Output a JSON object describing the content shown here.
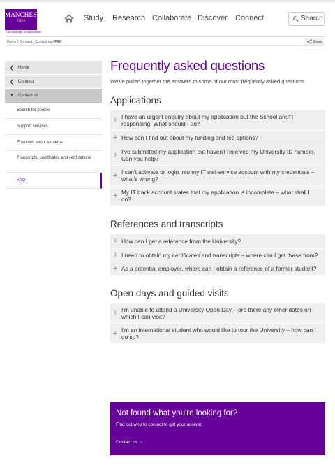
{
  "header": {
    "logo_main": "MANCHESTER",
    "logo_year": "1824",
    "logo_sub": "The University of Manchester",
    "nav": [
      "Study",
      "Research",
      "Collaborate",
      "Discover",
      "Connect"
    ],
    "search_label": "Search"
  },
  "breadcrumb": {
    "items": [
      "Home",
      "Connect",
      "Contact us"
    ],
    "separator": "/",
    "current": "FAQ",
    "share_label": "Share"
  },
  "sidebar": {
    "parents": [
      "Home",
      "Connect",
      "Contact us"
    ],
    "children": [
      "Search for people",
      "Support services",
      "Enquiries about students",
      "Transcripts, certificates and verifications",
      "FAQ"
    ]
  },
  "main": {
    "title": "Frequently asked questions",
    "intro": "We've pulled together the answers to some of our most frequently asked questions.",
    "sections": [
      {
        "heading": "Applications",
        "questions": [
          "I have an urgent enquiry about my application but the School aren't responding. What should I do?",
          "How can I find out about my funding and fee options?",
          "I've submitted my application but haven't received my University ID number. Can you help?",
          "I can't activate or login into my IT self-service account with my credentials – what's wrong?",
          "My IT track account states that my application is incomplete – what shall I do?"
        ]
      },
      {
        "heading": "References and transcripts",
        "questions": [
          "How can I get a reference from the University?",
          "I need to obtain my certificates and transcripts – where can I get these from?",
          "As a potential employer, where can I obtain a reference of a former student?"
        ]
      },
      {
        "heading": "Open days and guided visits",
        "questions": [
          "I'm unable to attend a University Open Day – are there any other dates on which I can visit?",
          "I'm an international student who would like to tour the University – how can I do so?"
        ]
      }
    ]
  },
  "cta": {
    "title": "Not found what you're looking for?",
    "text": "Find out who to contact to get your answer.",
    "link": "Contact us"
  },
  "colors": {
    "brand": "#660099",
    "gold": "#ffcc33",
    "faq_bg": "#efefef"
  },
  "icons": [
    "home-icon",
    "search-icon",
    "share-icon",
    "chevron-left-icon",
    "chevron-down-icon",
    "plus-icon",
    "chevron-right-icon"
  ]
}
